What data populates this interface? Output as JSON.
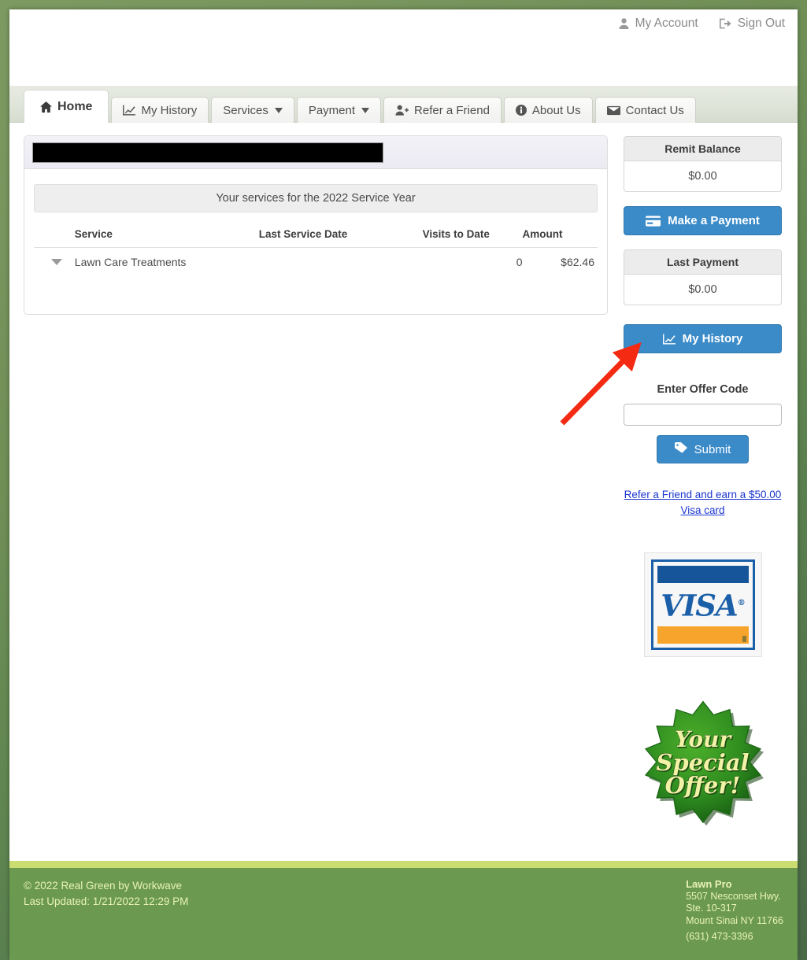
{
  "header": {
    "account_link_label": "My Account",
    "account_icon": "user-icon",
    "signout_label": "Sign Out",
    "signout_icon": "sign-out-icon"
  },
  "nav": {
    "tabs": [
      {
        "label": "Home",
        "icon": "home-icon",
        "active": true,
        "caret": false
      },
      {
        "label": "My History",
        "icon": "line-chart-icon",
        "active": false,
        "caret": false
      },
      {
        "label": "Services",
        "icon": "",
        "active": false,
        "caret": true
      },
      {
        "label": "Payment",
        "icon": "",
        "active": false,
        "caret": true
      },
      {
        "label": "Refer a Friend",
        "icon": "user-plus-icon",
        "active": false,
        "caret": false
      },
      {
        "label": "About Us",
        "icon": "info-icon",
        "active": false,
        "caret": false
      },
      {
        "label": "Contact Us",
        "icon": "envelope-icon",
        "active": false,
        "caret": false
      }
    ]
  },
  "main": {
    "account_name_redacted": "",
    "service_year_banner": "Your services for the 2022 Service Year",
    "table": {
      "columns": [
        "Service",
        "Last Service Date",
        "Visits to Date",
        "Amount"
      ],
      "rows": [
        {
          "toggle_icon": "caret-down-icon",
          "service": "Lawn Care Treatments",
          "last_service_date": "",
          "visits_to_date": "0",
          "amount": "$62.46"
        }
      ]
    }
  },
  "sidebar": {
    "remit_balance_label": "Remit Balance",
    "remit_balance_value": "$0.00",
    "make_payment_label": "Make a Payment",
    "make_payment_icon": "credit-card-icon",
    "last_payment_label": "Last Payment",
    "last_payment_value": "$0.00",
    "my_history_label": "My History",
    "my_history_icon": "line-chart-icon",
    "offer_code_label": "Enter Offer Code",
    "offer_code_value": "",
    "offer_code_placeholder": "",
    "submit_label": "Submit",
    "submit_icon": "tag-icon",
    "refer_link_line1": "Refer a Friend and earn a $50.00",
    "refer_link_line2": "Visa card",
    "visa_logo_text": "VISA",
    "special_offer_line1": "Your",
    "special_offer_line2": "Special",
    "special_offer_line3": "Offer!"
  },
  "footer": {
    "copyright": "© 2022 Real Green by Workwave",
    "last_updated": "Last Updated: 1/21/2022 12:29 PM",
    "business_name": "Lawn Pro",
    "address_line1": "5507 Nesconset Hwy.",
    "address_line2": "Ste. 10-317",
    "address_line3": "Mount Sinai NY 11766",
    "phone": "(631) 473-3396"
  },
  "annotation": {
    "arrow_color": "#f42a12",
    "arrow_target": "make-a-payment-button"
  },
  "colors": {
    "primary_blue": "#3b8bc9",
    "footer_green": "#6b9950",
    "footer_accent": "#c9dd70",
    "link_blue": "#1a36d0"
  }
}
